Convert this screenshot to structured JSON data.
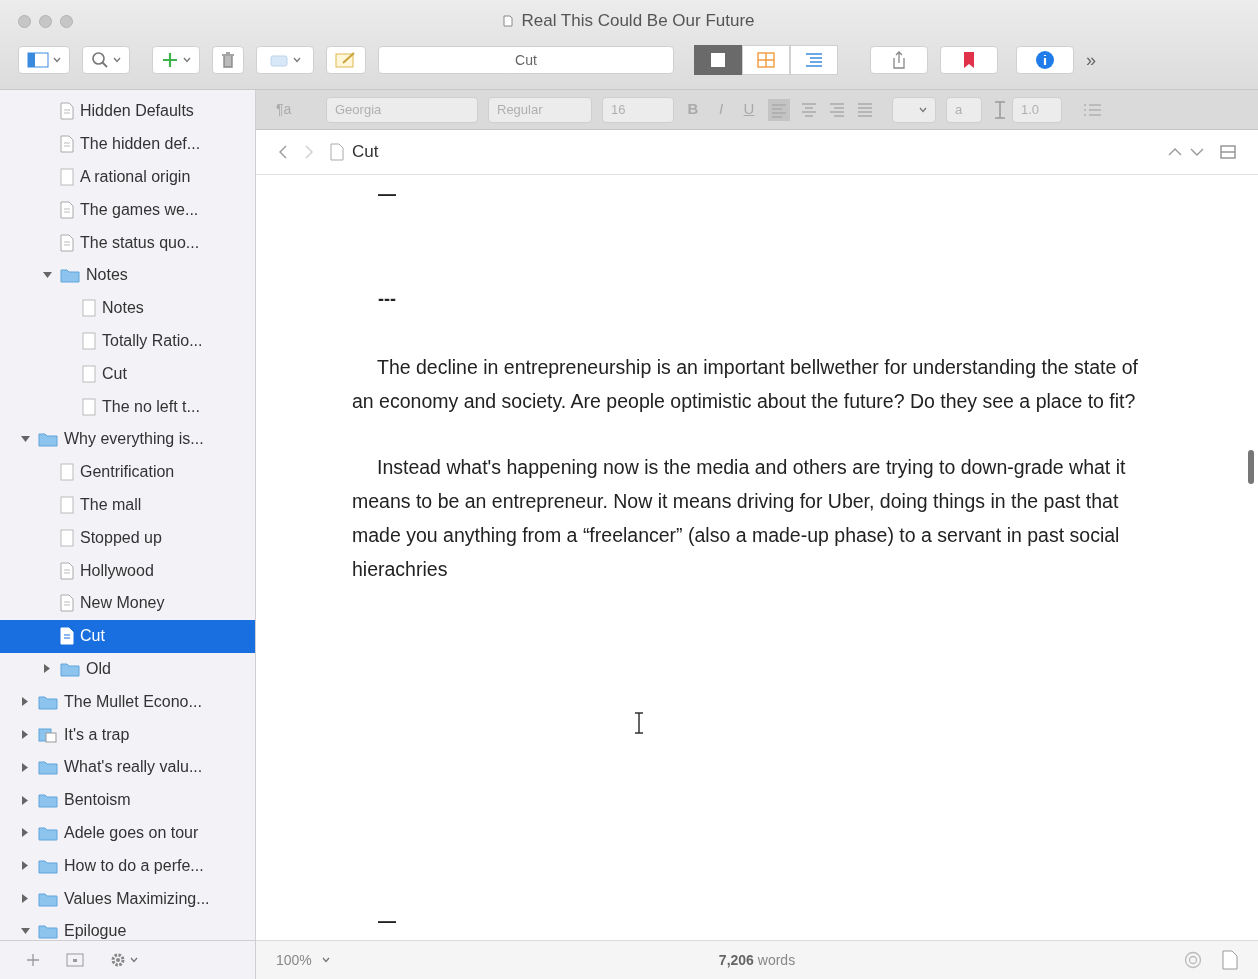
{
  "window": {
    "title": "Real This Could Be Our Future"
  },
  "toolbar": {
    "location": "Cut",
    "view_modes": [
      {
        "selected": true
      },
      {
        "selected": false
      },
      {
        "selected": false
      }
    ],
    "overflow": "»"
  },
  "format_bar": {
    "paragraph": "¶a",
    "font": "Georgia",
    "weight": "Regular",
    "size": "16",
    "bold": "B",
    "italic": "I",
    "underline": "U",
    "highlight": "a",
    "line_spacing": "1.0"
  },
  "header": {
    "title": "Cut"
  },
  "binder": {
    "partial_group": [
      {
        "label": "Hidden Defaults",
        "kind": "doc",
        "selected": false
      },
      {
        "label": "The hidden def...",
        "kind": "doc",
        "selected": false
      },
      {
        "label": "A rational origin",
        "kind": "note",
        "selected": false
      },
      {
        "label": "The games we...",
        "kind": "doc",
        "selected": false
      },
      {
        "label": "The status quo...",
        "kind": "doc",
        "selected": false
      },
      {
        "label": "Notes",
        "kind": "folder",
        "expanded": true,
        "selected": false,
        "children": [
          {
            "label": "Notes",
            "kind": "note",
            "selected": false
          },
          {
            "label": "Totally Ratio...",
            "kind": "note",
            "selected": false
          },
          {
            "label": "Cut",
            "kind": "note",
            "selected": false
          },
          {
            "label": "The no left t...",
            "kind": "note",
            "selected": false
          }
        ]
      }
    ],
    "items": [
      {
        "label": "Why everything is...",
        "kind": "folder",
        "expanded": true,
        "selected": false,
        "children": [
          {
            "label": "Gentrification",
            "kind": "note",
            "selected": false
          },
          {
            "label": "The mall",
            "kind": "note",
            "selected": false
          },
          {
            "label": "Stopped up",
            "kind": "note",
            "selected": false
          },
          {
            "label": "Hollywood",
            "kind": "doc",
            "selected": false
          },
          {
            "label": "New Money",
            "kind": "doc",
            "selected": false
          },
          {
            "label": "Cut",
            "kind": "doc",
            "selected": true
          },
          {
            "label": "Old",
            "kind": "folder",
            "expanded": false,
            "selected": false
          }
        ]
      },
      {
        "label": "The Mullet Econo...",
        "kind": "folder",
        "expanded": false,
        "selected": false
      },
      {
        "label": "It's a trap",
        "kind": "stack",
        "expanded": false,
        "selected": false
      },
      {
        "label": "What's really valu...",
        "kind": "folder",
        "expanded": false,
        "selected": false
      },
      {
        "label": "Bentoism",
        "kind": "folder",
        "expanded": false,
        "selected": false
      },
      {
        "label": "Adele goes on tour",
        "kind": "folder",
        "expanded": false,
        "selected": false
      },
      {
        "label": "How to do a perfe...",
        "kind": "folder",
        "expanded": false,
        "selected": false
      },
      {
        "label": "Values Maximizing...",
        "kind": "folder",
        "expanded": false,
        "selected": false
      },
      {
        "label": "Epilogue",
        "kind": "folder",
        "expanded": true,
        "selected": false
      }
    ]
  },
  "editor": {
    "blocks": [
      {
        "kind": "mark",
        "text": "—"
      },
      {
        "kind": "mark",
        "text": "---"
      },
      {
        "kind": "paragraph",
        "text": "The decline in entrepreneurship is an important bellwether for understanding the state of an economy and society. Are people optimistic about the future? Do they see a place to fit?"
      },
      {
        "kind": "paragraph",
        "text": "Instead what's happening now is the media and others are trying to down-grade what it means to be an entrepreneur. Now it means driving for Uber, doing things in the past that made you anything from a “freelancer” (also a made-up phase) to a servant in past social hierachries"
      },
      {
        "kind": "mark",
        "text": "—"
      }
    ]
  },
  "footer": {
    "zoom": "100%",
    "word_count": "7,206",
    "word_label": "words"
  }
}
